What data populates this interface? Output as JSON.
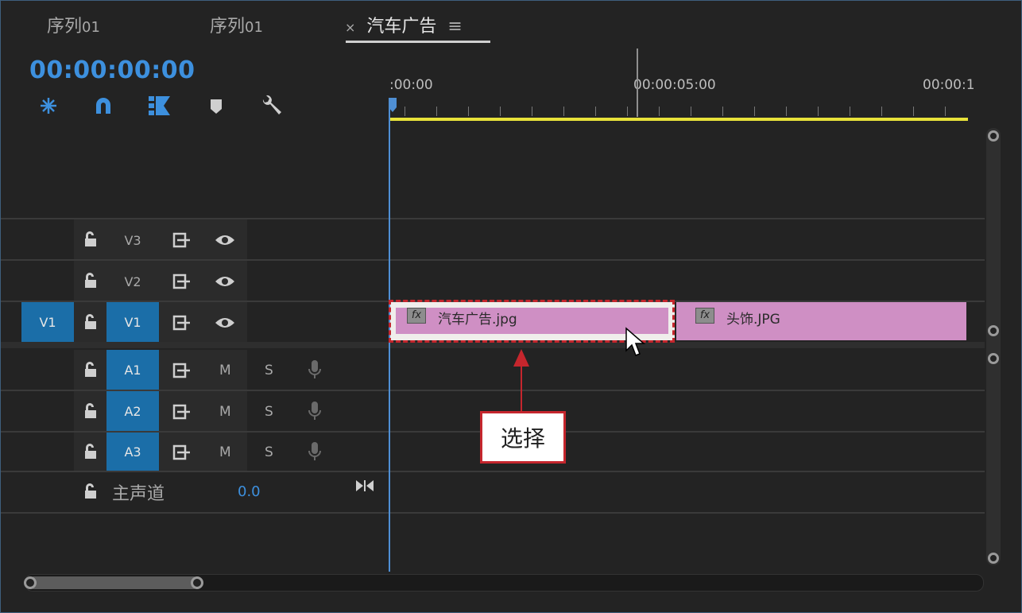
{
  "tabs": [
    {
      "label": "序列",
      "num": "01"
    },
    {
      "label": "序列",
      "num": "01"
    },
    {
      "label": "汽车广告",
      "close": "×",
      "menu": "≡"
    }
  ],
  "timecode": "00:00:00:00",
  "ruler": {
    "labels": [
      ":00:00",
      "00:00:05:00",
      "00:00:1"
    ]
  },
  "tracks": {
    "v3": {
      "name": "V3"
    },
    "v2": {
      "name": "V2"
    },
    "v1": {
      "source": "V1",
      "name": "V1"
    },
    "a1": {
      "name": "A1",
      "mute": "M",
      "solo": "S"
    },
    "a2": {
      "name": "A2",
      "mute": "M",
      "solo": "S"
    },
    "a3": {
      "name": "A3",
      "mute": "M",
      "solo": "S"
    }
  },
  "clips": [
    {
      "fx": "fx",
      "name": "汽车广告.jpg"
    },
    {
      "fx": "fx",
      "name": "头饰.JPG"
    }
  ],
  "master": {
    "label": "主声道",
    "value": "0.0"
  },
  "callout": {
    "text": "选择"
  },
  "colors": {
    "accent": "#3d90de",
    "clip": "#cf8fc4",
    "callout": "#c5262d",
    "workbar": "#e8e23a",
    "track_target": "#1b6ea8"
  },
  "icons": [
    "snap-icon",
    "linked-selection-icon",
    "insert-overwrite-icon",
    "marker-icon",
    "wrench-icon",
    "lock-icon",
    "sync-lock-icon",
    "eye-icon",
    "mic-icon",
    "cursor-icon"
  ]
}
